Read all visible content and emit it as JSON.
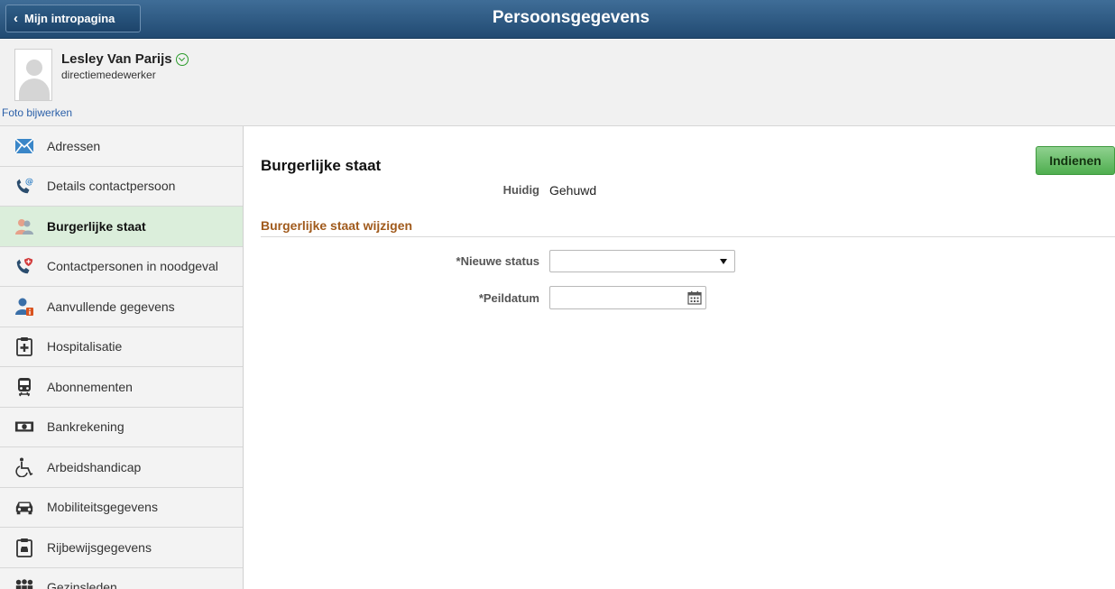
{
  "header": {
    "back_label": "Mijn intropagina",
    "title": "Persoonsgegevens"
  },
  "profile": {
    "name": "Lesley Van Parijs",
    "role": "directiemedewerker",
    "photo_link": "Foto bijwerken"
  },
  "sidebar": {
    "items": [
      {
        "label": "Adressen",
        "icon": "envelope-icon"
      },
      {
        "label": "Details contactpersoon",
        "icon": "phone-at-icon"
      },
      {
        "label": "Burgerlijke staat",
        "icon": "couple-icon"
      },
      {
        "label": "Contactpersonen in noodgeval",
        "icon": "phone-emergency-icon"
      },
      {
        "label": "Aanvullende gegevens",
        "icon": "person-info-icon"
      },
      {
        "label": "Hospitalisatie",
        "icon": "medical-clipboard-icon"
      },
      {
        "label": "Abonnementen",
        "icon": "train-icon"
      },
      {
        "label": "Bankrekening",
        "icon": "banknote-icon"
      },
      {
        "label": "Arbeidshandicap",
        "icon": "wheelchair-icon"
      },
      {
        "label": "Mobiliteitsgegevens",
        "icon": "car-icon"
      },
      {
        "label": "Rijbewijsgegevens",
        "icon": "license-clipboard-icon"
      },
      {
        "label": "Gezinsleden",
        "icon": "family-icon"
      }
    ],
    "active_index": 2
  },
  "main": {
    "submit_label": "Indienen",
    "section_title": "Burgerlijke staat",
    "current_label": "Huidig",
    "current_value": "Gehuwd",
    "subsection_title": "Burgerlijke staat wijzigen",
    "new_status_label": "*Nieuwe status",
    "new_status_value": "",
    "date_label": "*Peildatum",
    "date_value": ""
  },
  "colors": {
    "header": "#2b5782",
    "active_nav": "#dbeedb",
    "submit": "#5fb85f",
    "subsection": "#a05a1c",
    "link": "#2a5fa8"
  }
}
